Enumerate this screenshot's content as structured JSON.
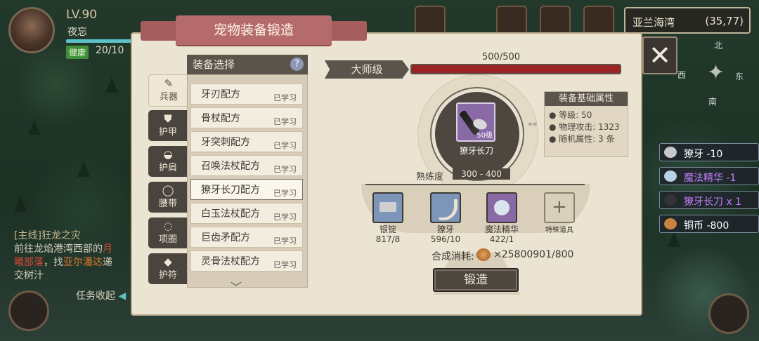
{
  "player": {
    "level": "LV.90",
    "name": "夜忘",
    "health_tag": "健康",
    "health_value": "20/10"
  },
  "location": {
    "name": "亚兰海湾",
    "coords": "(35,77)"
  },
  "compass": {
    "north": "北",
    "east": "东",
    "south": "南",
    "west": "西"
  },
  "quest": {
    "title": "[主线]",
    "title_rest": "狂龙之灾",
    "line1": "前往龙焰港湾西部的",
    "line1_hl": "月",
    "line2_hl": "曦部落",
    "line2": "，找",
    "line2_npc": "亚尔潘达",
    "line2_end": "递",
    "line3": "交树汁",
    "collapse_label": "任务收起"
  },
  "panel": {
    "title": "宠物装备锻造",
    "close_glyph": "✕"
  },
  "tabs": [
    {
      "label": "兵器",
      "icon": "sword-icon",
      "glyph": "✎",
      "active": true
    },
    {
      "label": "护甲",
      "icon": "armor-icon",
      "glyph": "⛊",
      "active": false
    },
    {
      "label": "护肩",
      "icon": "shoulder-icon",
      "glyph": "◒",
      "active": false
    },
    {
      "label": "腰带",
      "icon": "belt-icon",
      "glyph": "◯",
      "active": false
    },
    {
      "label": "项圈",
      "icon": "collar-icon",
      "glyph": "◌",
      "active": false
    },
    {
      "label": "护符",
      "icon": "amulet-icon",
      "glyph": "◆",
      "active": false
    }
  ],
  "recipe_list": {
    "header": "装备选择",
    "help_glyph": "?",
    "items": [
      {
        "name": "牙刃配方",
        "status": "已学习"
      },
      {
        "name": "骨杖配方",
        "status": "已学习"
      },
      {
        "name": "牙突刺配方",
        "status": "已学习"
      },
      {
        "name": "召唤法杖配方",
        "status": "已学习"
      },
      {
        "name": "獠牙长刀配方",
        "status": "已学习",
        "selected": true
      },
      {
        "name": "白玉法杖配方",
        "status": "已学习"
      },
      {
        "name": "巨齿矛配方",
        "status": "已学习"
      },
      {
        "name": "灵骨法杖配方",
        "status": "已学习"
      }
    ]
  },
  "grade": {
    "label": "大师级",
    "progress_text": "500/500",
    "progress": 1.0
  },
  "item": {
    "name": "獠牙长刀",
    "level_text": "50级"
  },
  "attributes": {
    "header": "装备基础属性",
    "rows": [
      "等级: 50",
      "物理攻击: 1323",
      "随机属性: 3 条"
    ]
  },
  "proficiency": {
    "label": "熟练度",
    "value": "300 - 400"
  },
  "materials": [
    {
      "name": "银锭",
      "count": "817/8",
      "icon": "silver-ingot-icon",
      "color": "#7d95b8"
    },
    {
      "name": "獠牙",
      "count": "596/10",
      "icon": "fang-icon",
      "color": "#7d95b8"
    },
    {
      "name": "魔法精华",
      "count": "422/1",
      "icon": "magic-essence-icon",
      "color": "#8a6aa6"
    },
    {
      "name": "特殊道具",
      "count": "",
      "icon": "plus-icon",
      "color": "#d9cfbb"
    }
  ],
  "cost": {
    "label": "合成消耗:",
    "value": "×25800901/800"
  },
  "forge_button": "锻造",
  "notifications": [
    {
      "text": "獠牙 -10",
      "color": "#ffffff"
    },
    {
      "text": "魔法精华 -1",
      "color": "#c77dff"
    },
    {
      "text": "獠牙长刀 x 1",
      "color": "#c77dff"
    },
    {
      "text": "铜币 -800",
      "color": "#ffffff"
    }
  ]
}
